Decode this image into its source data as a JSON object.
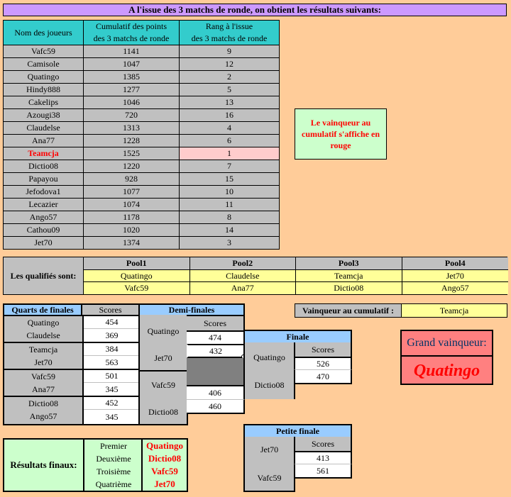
{
  "banner": "A l'issue des 3 matchs de ronde, on obtient les résultats suivants:",
  "ranking_table": {
    "headers": [
      "Nom des joueurs",
      "Cumulatif des points des 3 matchs de ronde",
      "Rang à l'issue des 3 matchs de ronde"
    ],
    "header_lines": {
      "col1": [
        "Nom des joueurs"
      ],
      "col2": [
        "Cumulatif des points",
        "des 3 matchs de ronde"
      ],
      "col3": [
        "Rang à l'issue",
        "des 3 matchs de ronde"
      ]
    },
    "rows": [
      {
        "name": "Vafc59",
        "points": "1141",
        "rank": "9"
      },
      {
        "name": "Camisole",
        "points": "1047",
        "rank": "12"
      },
      {
        "name": "Quatingo",
        "points": "1385",
        "rank": "2"
      },
      {
        "name": "Hindy888",
        "points": "1277",
        "rank": "5"
      },
      {
        "name": "Cakelips",
        "points": "1046",
        "rank": "13"
      },
      {
        "name": "Azougi38",
        "points": "720",
        "rank": "16"
      },
      {
        "name": "Claudelse",
        "points": "1313",
        "rank": "4"
      },
      {
        "name": "Ana77",
        "points": "1228",
        "rank": "6"
      },
      {
        "name": "Teamcja",
        "points": "1525",
        "rank": "1",
        "highlight": true
      },
      {
        "name": "Dictio08",
        "points": "1220",
        "rank": "7"
      },
      {
        "name": "Papayou",
        "points": "928",
        "rank": "15"
      },
      {
        "name": "Jefodova1",
        "points": "1077",
        "rank": "10"
      },
      {
        "name": "Lecazier",
        "points": "1074",
        "rank": "11"
      },
      {
        "name": "Ango57",
        "points": "1178",
        "rank": "8"
      },
      {
        "name": "Cathou09",
        "points": "1020",
        "rank": "14"
      },
      {
        "name": "Jet70",
        "points": "1374",
        "rank": "3"
      }
    ]
  },
  "note": "Le vainqueur au cumulatif s'affiche en rouge",
  "qualified": {
    "label": "Les qualifiés sont:",
    "pools": [
      {
        "name": "Pool1",
        "players": [
          "Quatingo",
          "Vafc59"
        ]
      },
      {
        "name": "Pool2",
        "players": [
          "Claudelse",
          "Ana77"
        ]
      },
      {
        "name": "Pool3",
        "players": [
          "Teamcja",
          "Dictio08"
        ]
      },
      {
        "name": "Pool4",
        "players": [
          "Jet70",
          "Ango57"
        ]
      }
    ]
  },
  "quarterfinals": {
    "title": "Quarts de finales",
    "scores_label": "Scores",
    "matches": [
      [
        {
          "player": "Quatingo",
          "score": "454"
        },
        {
          "player": "Claudelse",
          "score": "369"
        }
      ],
      [
        {
          "player": "Teamcja",
          "score": "384"
        },
        {
          "player": "Jet70",
          "score": "563"
        }
      ],
      [
        {
          "player": "Vafc59",
          "score": "501"
        },
        {
          "player": "Ana77",
          "score": "345"
        }
      ],
      [
        {
          "player": "Dictio08",
          "score": "452"
        },
        {
          "player": "Ango57",
          "score": "345"
        }
      ]
    ]
  },
  "semifinals": {
    "title": "Demi-finales",
    "scores_label": "Scores",
    "matches": [
      [
        {
          "player": "Quatingo",
          "score": "474"
        },
        {
          "player": "Jet70",
          "score": "432"
        }
      ],
      [
        {
          "player": "Vafc59",
          "score": "406"
        },
        {
          "player": "Dictio08",
          "score": "460"
        }
      ]
    ]
  },
  "final": {
    "title": "Finale",
    "scores_label": "Scores",
    "match": [
      {
        "player": "Quatingo",
        "score": "526"
      },
      {
        "player": "Dictio08",
        "score": "470"
      }
    ]
  },
  "small_final": {
    "title": "Petite finale",
    "scores_label": "Scores",
    "match": [
      {
        "player": "Jet70",
        "score": "413"
      },
      {
        "player": "Vafc59",
        "score": "561"
      }
    ]
  },
  "cumulative_winner": {
    "label": "Vainqueur au cumulatif :",
    "value": "Teamcja"
  },
  "grand_winner": {
    "label": "Grand vainqueur:",
    "value": "Quatingo"
  },
  "final_results": {
    "label": "Résultats finaux:",
    "places": [
      {
        "place": "Premier",
        "player": "Quatingo"
      },
      {
        "place": "Deuxième",
        "player": "Dictio08"
      },
      {
        "place": "Troisième",
        "player": "Vafc59"
      },
      {
        "place": "Quatrième",
        "player": "Jet70"
      }
    ]
  },
  "colors": {
    "background": "#ffcc99",
    "banner": "#cc99ff",
    "header_teal": "#33cccc",
    "gray": "#c0c0c0",
    "yellow": "#ffff99",
    "light_green": "#ccffcc",
    "blue": "#99ccff",
    "winner_pink": "#ffcccc",
    "grand_winner_bg": "#ff8080",
    "winner_red": "#ff0000"
  }
}
